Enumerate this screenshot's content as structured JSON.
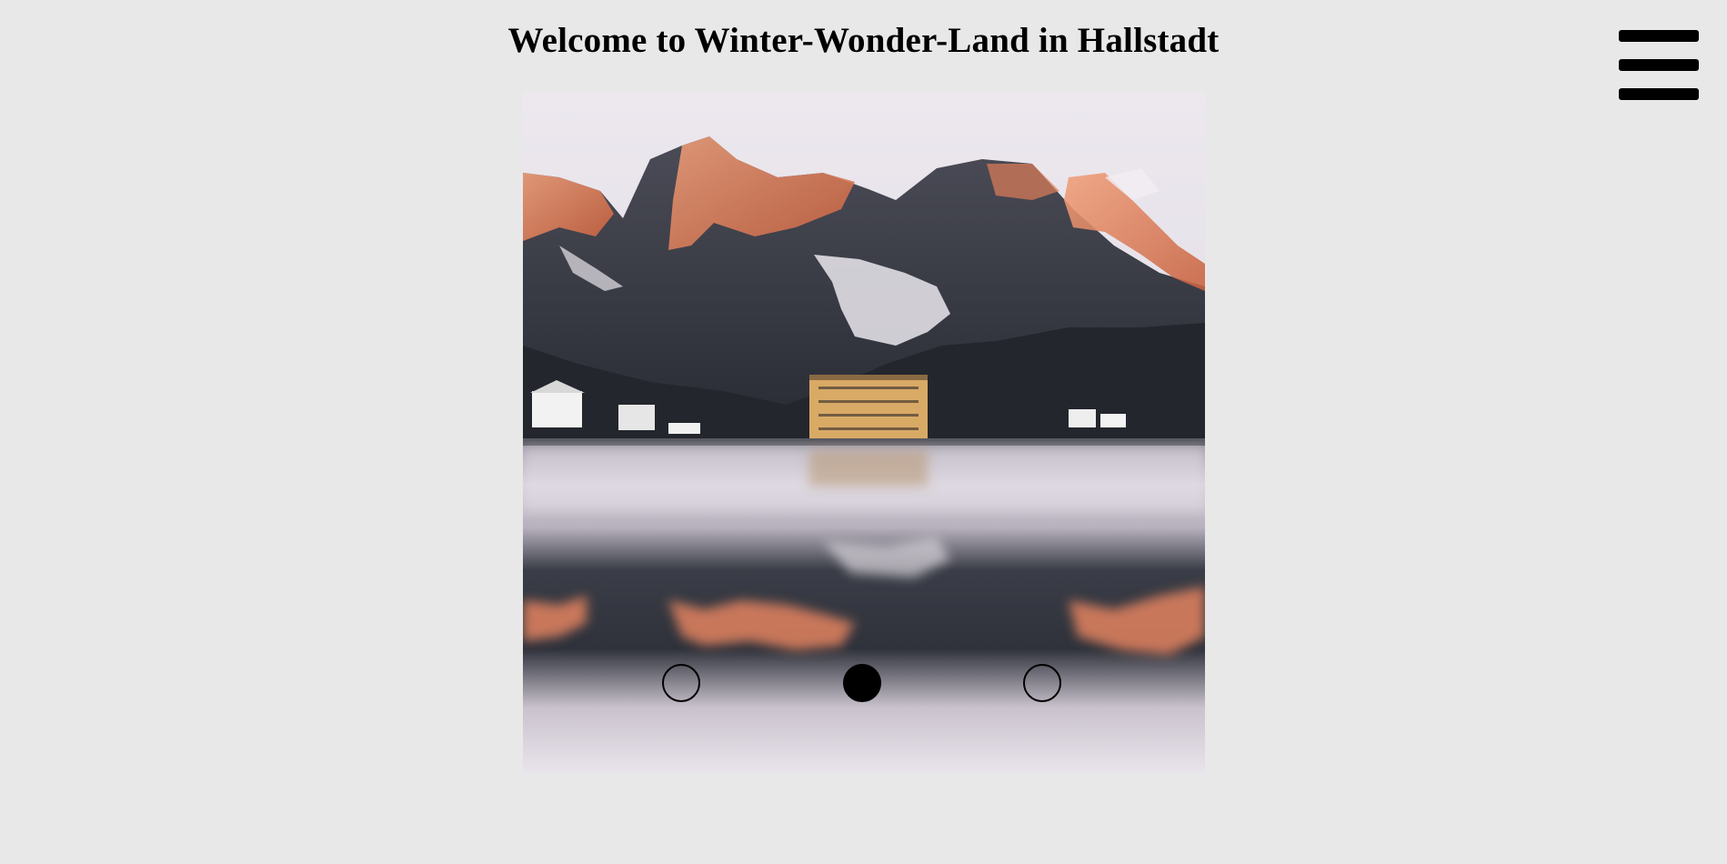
{
  "header": {
    "title": "Welcome to Winter-Wonder-Land in Hallstadt"
  },
  "menu": {
    "icon": "hamburger-menu-icon"
  },
  "slideshow": {
    "image": "mountain-lake-reflection-photo",
    "active_slide": 2,
    "slide_count": 3,
    "colors": {
      "sky": "#ebe6ec",
      "rock": "#3a3d47",
      "alpenglow": "#e5845e",
      "snow": "#e8e6ea",
      "water": "#c9c3cf",
      "building": "#d9aa66"
    }
  },
  "dots": [
    {
      "label": "slide 1",
      "active": false
    },
    {
      "label": "slide 2",
      "active": true
    },
    {
      "label": "slide 3",
      "active": false
    }
  ]
}
